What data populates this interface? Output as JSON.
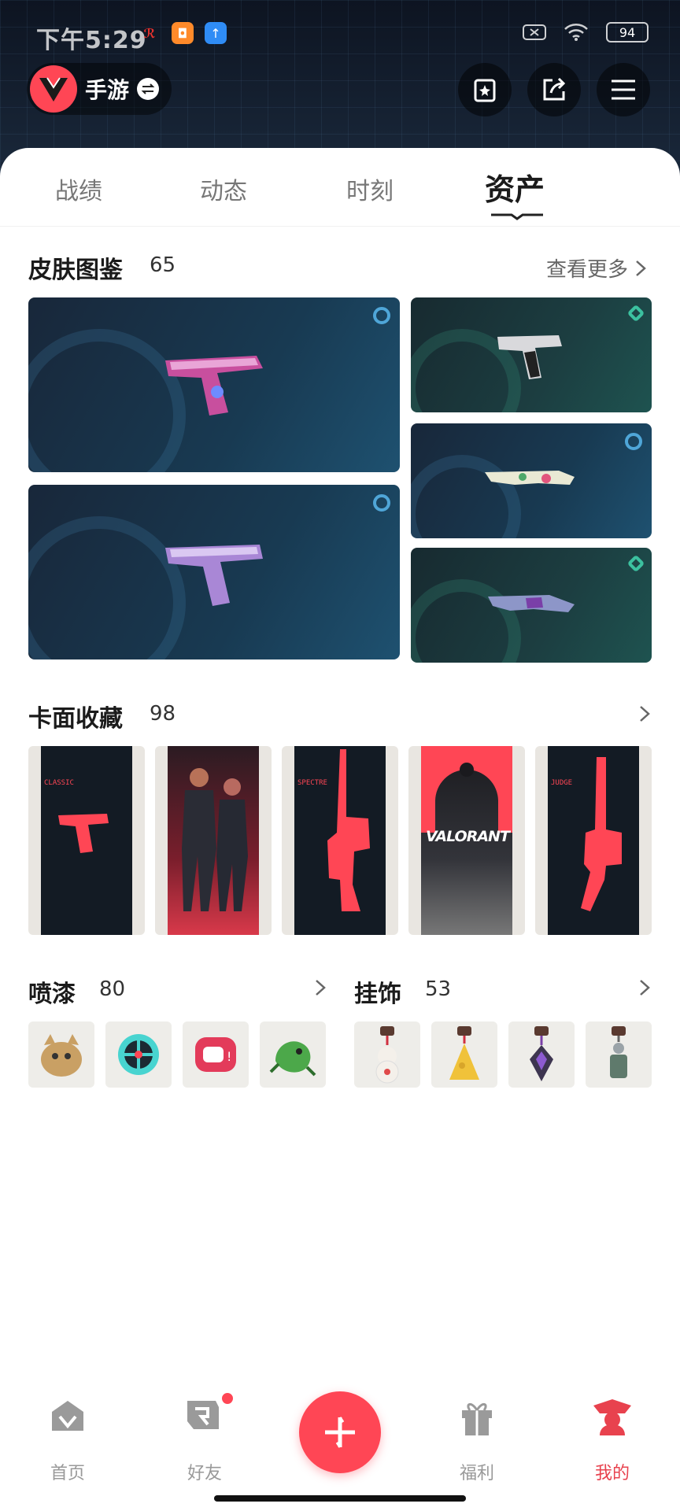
{
  "status_bar": {
    "time": "下午5:29",
    "battery": "94"
  },
  "header": {
    "game_name": "手游",
    "actions": [
      "magic-card-icon",
      "share-icon",
      "menu-icon"
    ]
  },
  "tabs": [
    {
      "label": "战绩",
      "active": false
    },
    {
      "label": "动态",
      "active": false
    },
    {
      "label": "时刻",
      "active": false
    },
    {
      "label": "资产",
      "active": true
    }
  ],
  "skins": {
    "title": "皮肤图鉴",
    "count": "65",
    "more": "查看更多"
  },
  "cards": {
    "title": "卡面收藏",
    "count": "98",
    "items": [
      "CLASSIC",
      "",
      "SPECTRE",
      "VALORANT",
      "JUDGE"
    ]
  },
  "sprays": {
    "title": "喷漆",
    "count": "80"
  },
  "charms": {
    "title": "挂饰",
    "count": "53"
  },
  "nav": {
    "home": "首页",
    "friends": "好友",
    "welfare": "福利",
    "mine": "我的"
  },
  "colors": {
    "accent": "#ff4655",
    "dark_bg": "#0d1421"
  }
}
